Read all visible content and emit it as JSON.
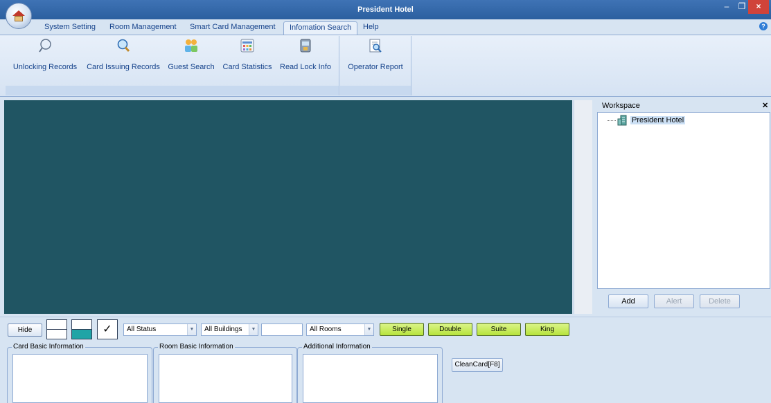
{
  "window": {
    "title": "President Hotel"
  },
  "menu_tabs": [
    "System Setting",
    "Room Management",
    "Smart Card Management",
    "Infomation Search",
    "Help"
  ],
  "active_tab": "Infomation Search",
  "ribbon": {
    "buttons": [
      {
        "label": "Unlocking Records",
        "icon": "magnifier-outline-icon"
      },
      {
        "label": "Card Issuing Records",
        "icon": "magnifier-icon"
      },
      {
        "label": "Guest Search",
        "icon": "guests-icon"
      },
      {
        "label": "Card Statistics",
        "icon": "statistics-grid-icon"
      },
      {
        "label": "Read Lock Info",
        "icon": "lock-reader-icon"
      },
      {
        "label": "Operator Report",
        "icon": "report-search-icon"
      }
    ]
  },
  "colors": {
    "main_view_bg": "#205563",
    "accent_green": "#b7e33c",
    "title_bar": "#2b5f9f"
  },
  "workspace": {
    "title": "Workspace",
    "tree": [
      {
        "label": "President Hotel",
        "icon": "building-icon"
      }
    ],
    "buttons": {
      "add": "Add",
      "alert": "Alert",
      "delete": "Delete"
    }
  },
  "filterbar": {
    "hide_label": "Hide",
    "check_glyph": "✓",
    "status_select": "All Status",
    "buildings_select": "All Buildings",
    "room_number_input": "",
    "rooms_select": "All Rooms",
    "room_types": [
      "Single",
      "Double",
      "Suite",
      "King"
    ]
  },
  "info_groups": {
    "card_basic": "Card Basic Information",
    "room_basic": "Room Basic Information",
    "additional": "Additional Information",
    "clean_card": "CleanCard[F8]"
  }
}
